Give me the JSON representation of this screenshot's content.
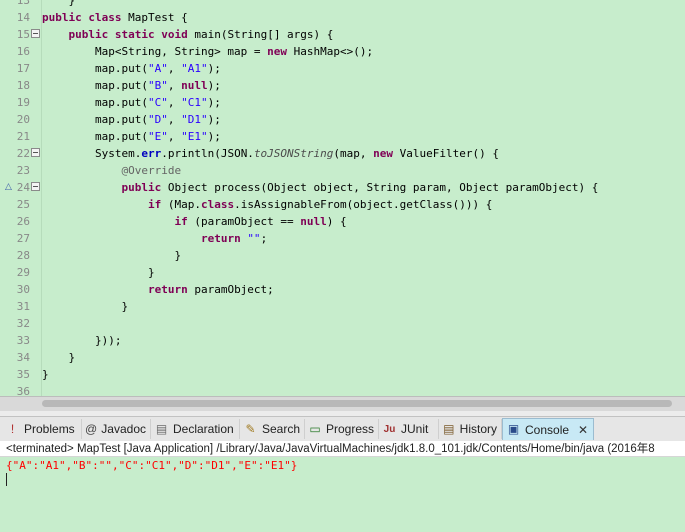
{
  "editor": {
    "lines": [
      {
        "num": "13",
        "tokens": [
          {
            "t": "plain",
            "v": "    }"
          }
        ]
      },
      {
        "num": "14",
        "tokens": [
          {
            "t": "kw",
            "v": "public class "
          },
          {
            "t": "plain",
            "v": "MapTest {"
          }
        ]
      },
      {
        "num": "15",
        "fold": true,
        "tokens": [
          {
            "t": "plain",
            "v": "    "
          },
          {
            "t": "kw",
            "v": "public static void "
          },
          {
            "t": "plain",
            "v": "main(String[] args) {"
          }
        ]
      },
      {
        "num": "16",
        "tokens": [
          {
            "t": "plain",
            "v": "        Map<String, String> map = "
          },
          {
            "t": "kw",
            "v": "new "
          },
          {
            "t": "plain",
            "v": "HashMap<>();"
          }
        ]
      },
      {
        "num": "17",
        "tokens": [
          {
            "t": "plain",
            "v": "        map.put("
          },
          {
            "t": "str",
            "v": "\"A\""
          },
          {
            "t": "plain",
            "v": ", "
          },
          {
            "t": "str",
            "v": "\"A1\""
          },
          {
            "t": "plain",
            "v": ");"
          }
        ]
      },
      {
        "num": "18",
        "tokens": [
          {
            "t": "plain",
            "v": "        map.put("
          },
          {
            "t": "str",
            "v": "\"B\""
          },
          {
            "t": "plain",
            "v": ", "
          },
          {
            "t": "kw",
            "v": "null"
          },
          {
            "t": "plain",
            "v": ");"
          }
        ]
      },
      {
        "num": "19",
        "tokens": [
          {
            "t": "plain",
            "v": "        map.put("
          },
          {
            "t": "str",
            "v": "\"C\""
          },
          {
            "t": "plain",
            "v": ", "
          },
          {
            "t": "str",
            "v": "\"C1\""
          },
          {
            "t": "plain",
            "v": ");"
          }
        ]
      },
      {
        "num": "20",
        "tokens": [
          {
            "t": "plain",
            "v": "        map.put("
          },
          {
            "t": "str",
            "v": "\"D\""
          },
          {
            "t": "plain",
            "v": ", "
          },
          {
            "t": "str",
            "v": "\"D1\""
          },
          {
            "t": "plain",
            "v": ");"
          }
        ]
      },
      {
        "num": "21",
        "tokens": [
          {
            "t": "plain",
            "v": "        map.put("
          },
          {
            "t": "str",
            "v": "\"E\""
          },
          {
            "t": "plain",
            "v": ", "
          },
          {
            "t": "str",
            "v": "\"E1\""
          },
          {
            "t": "plain",
            "v": ");"
          }
        ]
      },
      {
        "num": "22",
        "fold": true,
        "tokens": [
          {
            "t": "plain",
            "v": "        System."
          },
          {
            "t": "fld",
            "v": "err"
          },
          {
            "t": "plain",
            "v": ".println(JSON."
          },
          {
            "t": "ital",
            "v": "toJSONString"
          },
          {
            "t": "plain",
            "v": "(map, "
          },
          {
            "t": "kw",
            "v": "new "
          },
          {
            "t": "plain",
            "v": "ValueFilter() {"
          }
        ]
      },
      {
        "num": "23",
        "tokens": [
          {
            "t": "plain",
            "v": "            "
          },
          {
            "t": "ann",
            "v": "@Override"
          }
        ]
      },
      {
        "num": "24",
        "fold": true,
        "override": true,
        "tokens": [
          {
            "t": "plain",
            "v": "            "
          },
          {
            "t": "kw",
            "v": "public "
          },
          {
            "t": "plain",
            "v": "Object process(Object object, String param, Object paramObject) {"
          }
        ]
      },
      {
        "num": "25",
        "tokens": [
          {
            "t": "plain",
            "v": "                "
          },
          {
            "t": "kw",
            "v": "if "
          },
          {
            "t": "plain",
            "v": "(Map."
          },
          {
            "t": "kw",
            "v": "class"
          },
          {
            "t": "plain",
            "v": ".isAssignableFrom(object.getClass())) {"
          }
        ]
      },
      {
        "num": "26",
        "tokens": [
          {
            "t": "plain",
            "v": "                    "
          },
          {
            "t": "kw",
            "v": "if "
          },
          {
            "t": "plain",
            "v": "(paramObject == "
          },
          {
            "t": "kw",
            "v": "null"
          },
          {
            "t": "plain",
            "v": ") {"
          }
        ]
      },
      {
        "num": "27",
        "tokens": [
          {
            "t": "plain",
            "v": "                        "
          },
          {
            "t": "kw",
            "v": "return "
          },
          {
            "t": "str",
            "v": "\"\""
          },
          {
            "t": "plain",
            "v": ";"
          }
        ]
      },
      {
        "num": "28",
        "tokens": [
          {
            "t": "plain",
            "v": "                    }"
          }
        ]
      },
      {
        "num": "29",
        "tokens": [
          {
            "t": "plain",
            "v": "                }"
          }
        ]
      },
      {
        "num": "30",
        "tokens": [
          {
            "t": "plain",
            "v": "                "
          },
          {
            "t": "kw",
            "v": "return "
          },
          {
            "t": "plain",
            "v": "paramObject;"
          }
        ]
      },
      {
        "num": "31",
        "tokens": [
          {
            "t": "plain",
            "v": "            }"
          }
        ]
      },
      {
        "num": "32",
        "tokens": []
      },
      {
        "num": "33",
        "tokens": [
          {
            "t": "plain",
            "v": "        }));"
          }
        ]
      },
      {
        "num": "34",
        "tokens": [
          {
            "t": "plain",
            "v": "    }"
          }
        ]
      },
      {
        "num": "35",
        "tokens": [
          {
            "t": "plain",
            "v": "}"
          }
        ]
      },
      {
        "num": "36",
        "tokens": []
      }
    ]
  },
  "tabs": [
    {
      "id": "problems",
      "label": "Problems",
      "icon": "problems-icon",
      "glyph": "!",
      "color": "#b03030"
    },
    {
      "id": "javadoc",
      "label": "Javadoc",
      "icon": "at-sign-icon",
      "glyph": "@",
      "color": "#444444"
    },
    {
      "id": "declaration",
      "label": "Declaration",
      "icon": "declaration-icon",
      "glyph": "▤",
      "color": "#6a6a6a"
    },
    {
      "id": "search",
      "label": "Search",
      "icon": "flashlight-icon",
      "glyph": "✎",
      "color": "#a07a20"
    },
    {
      "id": "progress",
      "label": "Progress",
      "icon": "progress-icon",
      "glyph": "▭",
      "color": "#2a7a2a"
    },
    {
      "id": "junit",
      "label": "JUnit",
      "icon": "junit-icon",
      "glyph": "Ju",
      "color": "#a03030"
    },
    {
      "id": "history",
      "label": "History",
      "icon": "history-icon",
      "glyph": "▤",
      "color": "#7a5a2a"
    },
    {
      "id": "console",
      "label": "Console",
      "icon": "console-icon",
      "glyph": "▣",
      "color": "#2a4a8a",
      "active": true
    }
  ],
  "console": {
    "header": "<terminated> MapTest [Java Application] /Library/Java/JavaVirtualMachines/jdk1.8.0_101.jdk/Contents/Home/bin/java (2016年8",
    "output": "{\"A\":\"A1\",\"B\":\"\",\"C\":\"C1\",\"D\":\"D1\",\"E\":\"E1\"}",
    "close_glyph": "✕"
  },
  "colors": {
    "editor_bg": "#c7edcc",
    "keyword": "#7f0055",
    "string": "#2a00ff",
    "field": "#0000c0",
    "console_error": "#ff0000"
  }
}
